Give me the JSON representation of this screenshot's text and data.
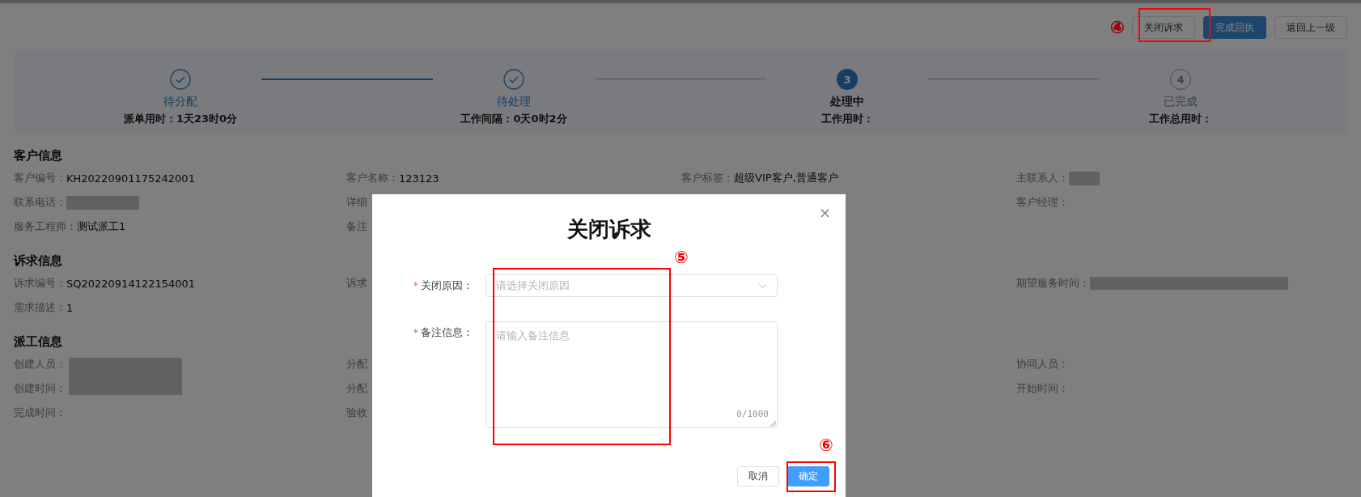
{
  "actions": [
    {
      "label": "关闭诉求",
      "kind": "default"
    },
    {
      "label": "完成回执",
      "kind": "primary"
    },
    {
      "label": "返回上一级",
      "kind": "default"
    }
  ],
  "steps": [
    {
      "title": "待分配",
      "time_label": "派单用时：",
      "time_value": "1天23时0分",
      "done": true
    },
    {
      "title": "待处理",
      "time_label": "工作间隔：",
      "time_value": "0天0时2分",
      "done": true
    },
    {
      "marker": "3",
      "title": "处理中",
      "time_label": "工作用时：",
      "done": false,
      "current": true
    },
    {
      "marker": "4",
      "title": "已完成",
      "time_label": "工作总用时：",
      "done": false,
      "current": false
    }
  ],
  "sections": [
    {
      "title": "客户信息",
      "rows": [
        [
          {
            "label": "客户编号：",
            "value": "KH20220901175242001"
          },
          {
            "label": "客户名称：",
            "value": "123123"
          },
          {
            "label": "客户标签：",
            "value": "超级VIP客户,普通客户"
          },
          {
            "label": "主联系人：",
            "redacted": true
          }
        ],
        [
          {
            "label": "联系电话：",
            "redacted": true
          },
          {
            "label": "详细"
          },
          {},
          {
            "label": "客户经理："
          }
        ],
        [
          {
            "label": "服务工程师：",
            "value": "测试派工1"
          },
          {
            "label": "备注"
          },
          {},
          {}
        ]
      ]
    },
    {
      "title": "诉求信息",
      "rows": [
        [
          {
            "label": "诉求编号：",
            "value": "SQ20220914122154001"
          },
          {
            "label": "诉求"
          },
          {},
          {
            "label": "期望服务时间：",
            "redacted": true
          }
        ],
        [
          {
            "label": "需求描述：",
            "value": "1"
          },
          {},
          {},
          {}
        ]
      ]
    },
    {
      "title": "派工信息",
      "rows": [
        [
          {
            "label": "创建人员：",
            "redacted": true
          },
          {
            "label": "分配"
          },
          {},
          {
            "label": "协同人员："
          }
        ],
        [
          {
            "label": "创建时间："
          },
          {
            "label": "分配"
          },
          {},
          {
            "label": "开始时间："
          }
        ],
        [
          {
            "label": "完成时间："
          },
          {
            "label": "验收"
          },
          {},
          {}
        ]
      ]
    }
  ],
  "dialog": {
    "title": "关闭诉求",
    "close": "×",
    "fields": [
      {
        "label": "关闭原因：",
        "required_mark": "*",
        "kind": "select",
        "placeholder": "请选择关闭原因"
      },
      {
        "label": "备注信息：",
        "required_mark": "*",
        "kind": "textarea",
        "placeholder": "请输入备注信息",
        "counter": "0/1000"
      }
    ],
    "buttons": [
      {
        "label": "取消",
        "kind": "default"
      },
      {
        "label": "确定",
        "kind": "primary"
      }
    ]
  },
  "annotations": [
    {
      "number": "④"
    },
    {
      "number": "⑤"
    },
    {
      "number": "⑥"
    }
  ]
}
